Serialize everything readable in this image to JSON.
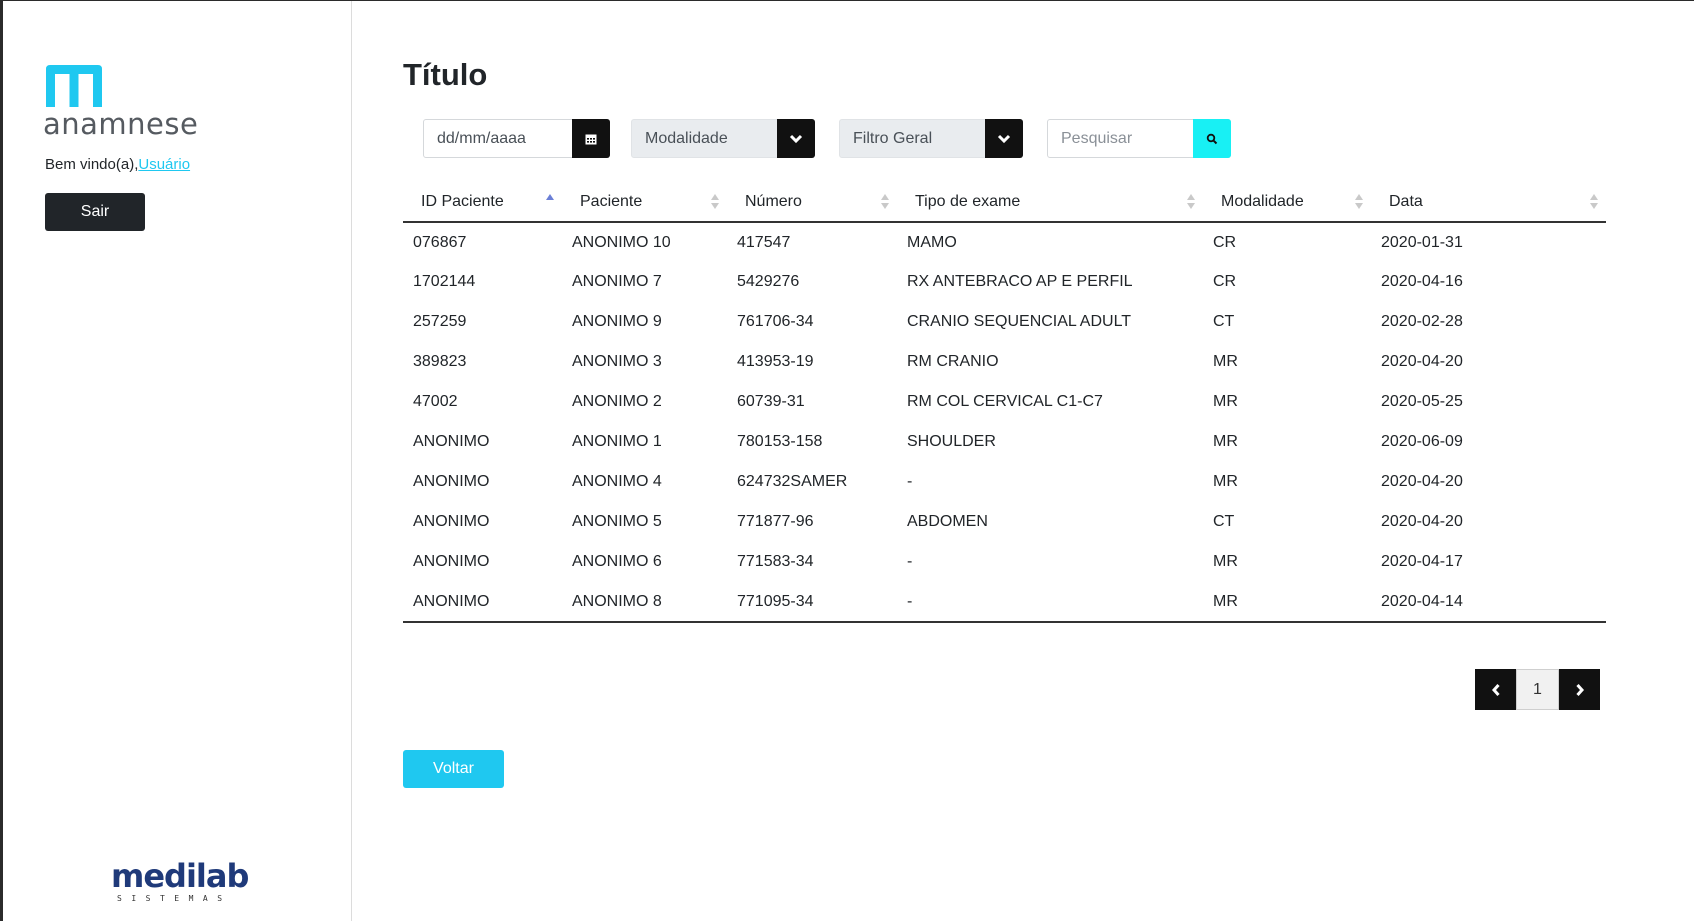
{
  "sidebar": {
    "app_name": "anamnese",
    "welcome_prefix": "Bem vindo(a),",
    "user_link": "Usuário",
    "logout_label": "Sair",
    "footer_logo_word": "medilab",
    "footer_logo_sub": "SISTEMAS"
  },
  "main": {
    "title": "Título",
    "filters": {
      "date_placeholder": "dd/mm/aaaa",
      "modality_label": "Modalidade",
      "general_filter_label": "Filtro Geral",
      "search_placeholder": "Pesquisar"
    },
    "table": {
      "columns": [
        "ID Paciente",
        "Paciente",
        "Número",
        "Tipo de exame",
        "Modalidade",
        "Data"
      ],
      "sorted_column": "ID Paciente",
      "sort_direction": "asc",
      "rows": [
        [
          "076867",
          "ANONIMO 10",
          "417547",
          "MAMO",
          "CR",
          "2020-01-31"
        ],
        [
          "1702144",
          "ANONIMO 7",
          "5429276",
          "RX ANTEBRACO AP E PERFIL",
          "CR",
          "2020-04-16"
        ],
        [
          "257259",
          "ANONIMO 9",
          "761706-34",
          "CRANIO SEQUENCIAL ADULT",
          "CT",
          "2020-02-28"
        ],
        [
          "389823",
          "ANONIMO 3",
          "413953-19",
          "RM CRANIO",
          "MR",
          "2020-04-20"
        ],
        [
          "47002",
          "ANONIMO 2",
          "60739-31",
          "RM COL CERVICAL C1-C7",
          "MR",
          "2020-05-25"
        ],
        [
          "ANONIMO",
          "ANONIMO 1",
          "780153-158",
          "SHOULDER",
          "MR",
          "2020-06-09"
        ],
        [
          "ANONIMO",
          "ANONIMO 4",
          "624732SAMER",
          "-",
          "MR",
          "2020-04-20"
        ],
        [
          "ANONIMO",
          "ANONIMO 5",
          "771877-96",
          "ABDOMEN",
          "CT",
          "2020-04-20"
        ],
        [
          "ANONIMO",
          "ANONIMO 6",
          "771583-34",
          "-",
          "MR",
          "2020-04-17"
        ],
        [
          "ANONIMO",
          "ANONIMO 8",
          "771095-34",
          "-",
          "MR",
          "2020-04-14"
        ]
      ]
    },
    "pagination": {
      "current_page": "1"
    },
    "back_label": "Voltar"
  },
  "colors": {
    "accent": "#1fc8f0",
    "dark": "#111111",
    "search_button": "#18f0f4",
    "brand_blue": "#1f3a7a"
  }
}
